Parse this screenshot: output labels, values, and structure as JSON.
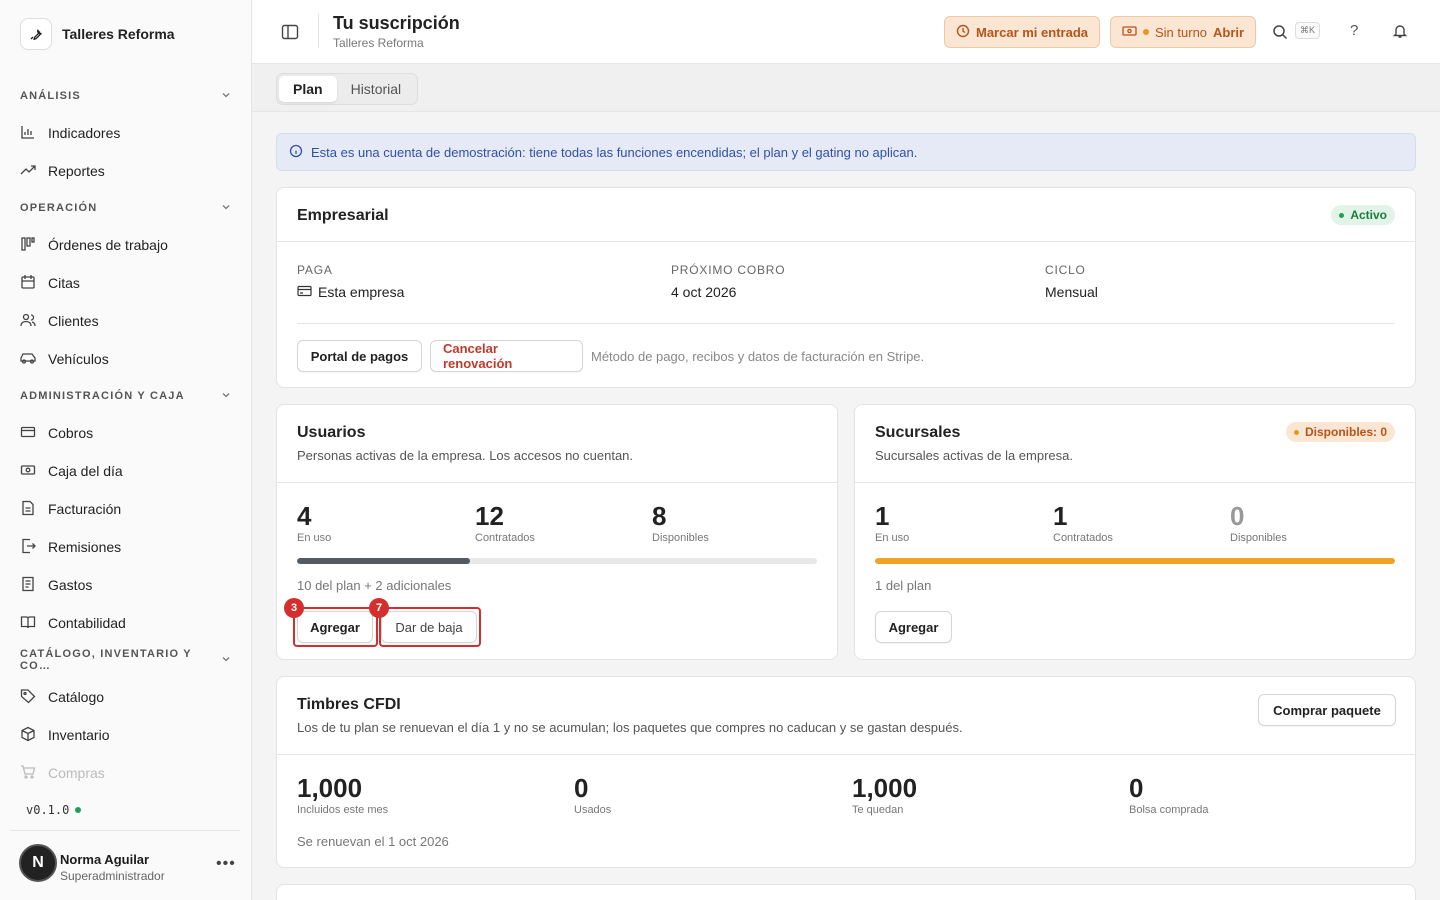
{
  "sidebar": {
    "brand": "Talleres Reforma",
    "sections": [
      {
        "title": "ANÁLISIS",
        "items": [
          "Indicadores",
          "Reportes"
        ]
      },
      {
        "title": "OPERACIÓN",
        "items": [
          "Órdenes de trabajo",
          "Citas",
          "Clientes",
          "Vehículos"
        ]
      },
      {
        "title": "ADMINISTRACIÓN Y CAJA",
        "items": [
          "Cobros",
          "Caja del día",
          "Facturación",
          "Remisiones",
          "Gastos",
          "Contabilidad"
        ]
      },
      {
        "title": "CATÁLOGO, INVENTARIO Y CO…",
        "items": [
          "Catálogo",
          "Inventario",
          "Compras"
        ]
      }
    ],
    "version": "v0.1.0",
    "user": {
      "initial": "N",
      "name": "Norma Aguilar",
      "role": "Superadministrador",
      "more": "•••"
    }
  },
  "header": {
    "title": "Tu suscripción",
    "subtitle": "Talleres Reforma",
    "entrada_label": "Marcar mi entrada",
    "turno_status": "Sin turno",
    "turno_action": "Abrir",
    "shortcut": "⌘K",
    "help": "?"
  },
  "tabs": [
    "Plan",
    "Historial"
  ],
  "banner": "Esta es una cuenta de demostración: tiene todas las funciones encendidas; el plan y el gating no aplican.",
  "plan": {
    "name": "Empresarial",
    "status": "Activo",
    "paga_label": "PAGA",
    "paga_value": "Esta empresa",
    "cobro_label": "PRÓXIMO COBRO",
    "cobro_value": "4 oct 2026",
    "ciclo_label": "CICLO",
    "ciclo_value": "Mensual",
    "portal_button": "Portal de pagos",
    "cancel_button": "Cancelar renovación",
    "note": "Método de pago, recibos y datos de facturación en Stripe."
  },
  "usuarios": {
    "title": "Usuarios",
    "subtitle": "Personas activas de la empresa. Los accesos no cuentan.",
    "en_uso": "4",
    "en_uso_label": "En uso",
    "contratados": "12",
    "contratados_label": "Contratados",
    "disponibles": "8",
    "disponibles_label": "Disponibles",
    "progress": 0.333,
    "bar_color": "#535a63",
    "note": "10 del plan + 2 adicionales",
    "add_button": "Agregar",
    "remove_button": "Dar de baja",
    "marker_add": "3",
    "marker_remove": "7"
  },
  "sucursales": {
    "title": "Sucursales",
    "badge": "Disponibles: 0",
    "subtitle": "Sucursales activas de la empresa.",
    "en_uso": "1",
    "en_uso_label": "En uso",
    "contratados": "1",
    "contratados_label": "Contratados",
    "disponibles": "0",
    "disponibles_label": "Disponibles",
    "progress": 1.0,
    "bar_color": "#f0a323",
    "note": "1 del plan",
    "add_button": "Agregar"
  },
  "timbres": {
    "title": "Timbres CFDI",
    "subtitle": "Los de tu plan se renuevan el día 1 y no se acumulan; los paquetes que compres no caducan y se gastan después.",
    "buy_button": "Comprar paquete",
    "stats": [
      {
        "value": "1,000",
        "label": "Incluidos este mes"
      },
      {
        "value": "0",
        "label": "Usados"
      },
      {
        "value": "1,000",
        "label": "Te quedan"
      },
      {
        "value": "0",
        "label": "Bolsa comprada"
      }
    ],
    "note": "Se renuevan el 1 oct 2026"
  }
}
